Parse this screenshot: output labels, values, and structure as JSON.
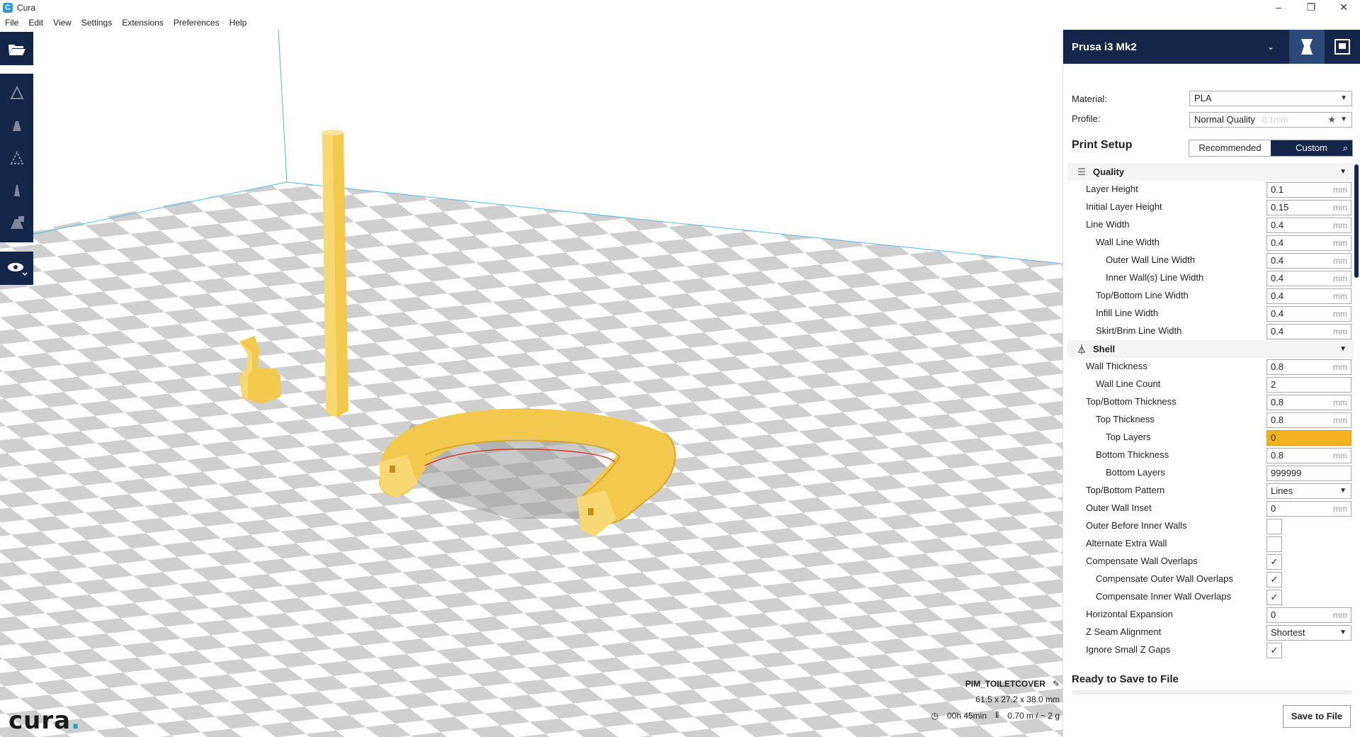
{
  "window": {
    "title": "Cura"
  },
  "menu": [
    "File",
    "Edit",
    "View",
    "Settings",
    "Extensions",
    "Preferences",
    "Help"
  ],
  "logo": {
    "text": "cura",
    "dot": "."
  },
  "job": {
    "name": "PIM_TOILETCOVER",
    "dimensions": "61.5 x 27.2 x 38.0 mm",
    "time": "00h 45min",
    "material_usage": "0.70 m / ~ 2 g"
  },
  "printer": {
    "name": "Prusa i3 Mk2"
  },
  "material": {
    "label": "Material:",
    "value": "PLA"
  },
  "profile": {
    "label": "Profile:",
    "value": "Normal Quality",
    "hint": "0.1mm"
  },
  "print_setup": {
    "title": "Print Setup",
    "tabs": [
      "Recommended",
      "Custom"
    ]
  },
  "categories": {
    "quality": "Quality",
    "shell": "Shell"
  },
  "quality_rows": [
    {
      "label": "Layer Height",
      "value": "0.1",
      "unit": "mm",
      "indent": 0
    },
    {
      "label": "Initial Layer Height",
      "value": "0.15",
      "unit": "mm",
      "indent": 0
    },
    {
      "label": "Line Width",
      "value": "0.4",
      "unit": "mm",
      "indent": 0
    },
    {
      "label": "Wall Line Width",
      "value": "0.4",
      "unit": "mm",
      "indent": 1
    },
    {
      "label": "Outer Wall Line Width",
      "value": "0.4",
      "unit": "mm",
      "indent": 2
    },
    {
      "label": "Inner Wall(s) Line Width",
      "value": "0.4",
      "unit": "mm",
      "indent": 2
    },
    {
      "label": "Top/Bottom Line Width",
      "value": "0.4",
      "unit": "mm",
      "indent": 1
    },
    {
      "label": "Infill Line Width",
      "value": "0.4",
      "unit": "mm",
      "indent": 1
    },
    {
      "label": "Skirt/Brim Line Width",
      "value": "0.4",
      "unit": "mm",
      "indent": 1
    }
  ],
  "shell_rows": [
    {
      "label": "Wall Thickness",
      "type": "num",
      "value": "0.8",
      "unit": "mm",
      "indent": 0
    },
    {
      "label": "Wall Line Count",
      "type": "num",
      "value": "2",
      "unit": "",
      "indent": 1
    },
    {
      "label": "Top/Bottom Thickness",
      "type": "num",
      "value": "0.8",
      "unit": "mm",
      "indent": 0
    },
    {
      "label": "Top Thickness",
      "type": "num",
      "value": "0.8",
      "unit": "mm",
      "indent": 1
    },
    {
      "label": "Top Layers",
      "type": "num",
      "value": "0",
      "unit": "",
      "indent": 2,
      "warn": true
    },
    {
      "label": "Bottom Thickness",
      "type": "num",
      "value": "0.8",
      "unit": "mm",
      "indent": 1
    },
    {
      "label": "Bottom Layers",
      "type": "num",
      "value": "999999",
      "unit": "",
      "indent": 2
    },
    {
      "label": "Top/Bottom Pattern",
      "type": "select",
      "value": "Lines",
      "indent": 0
    },
    {
      "label": "Outer Wall Inset",
      "type": "num",
      "value": "0",
      "unit": "mm",
      "indent": 0
    },
    {
      "label": "Outer Before Inner Walls",
      "type": "check",
      "checked": false,
      "indent": 0
    },
    {
      "label": "Alternate Extra Wall",
      "type": "check",
      "checked": false,
      "indent": 0
    },
    {
      "label": "Compensate Wall Overlaps",
      "type": "check",
      "checked": true,
      "indent": 0
    },
    {
      "label": "Compensate Outer Wall Overlaps",
      "type": "check",
      "checked": true,
      "indent": 1
    },
    {
      "label": "Compensate Inner Wall Overlaps",
      "type": "check",
      "checked": true,
      "indent": 1
    },
    {
      "label": "Horizontal Expansion",
      "type": "num",
      "value": "0",
      "unit": "mm",
      "indent": 0
    },
    {
      "label": "Z Seam Alignment",
      "type": "select",
      "value": "Shortest",
      "indent": 0
    },
    {
      "label": "Ignore Small Z Gaps",
      "type": "check",
      "checked": true,
      "indent": 0
    }
  ],
  "status": {
    "ready": "Ready to Save to File",
    "save_button": "Save to File"
  },
  "colors": {
    "navy": "#15264b",
    "accent": "#2a9ad6",
    "model": "#f5cd55",
    "warning": "#f3b21b"
  }
}
